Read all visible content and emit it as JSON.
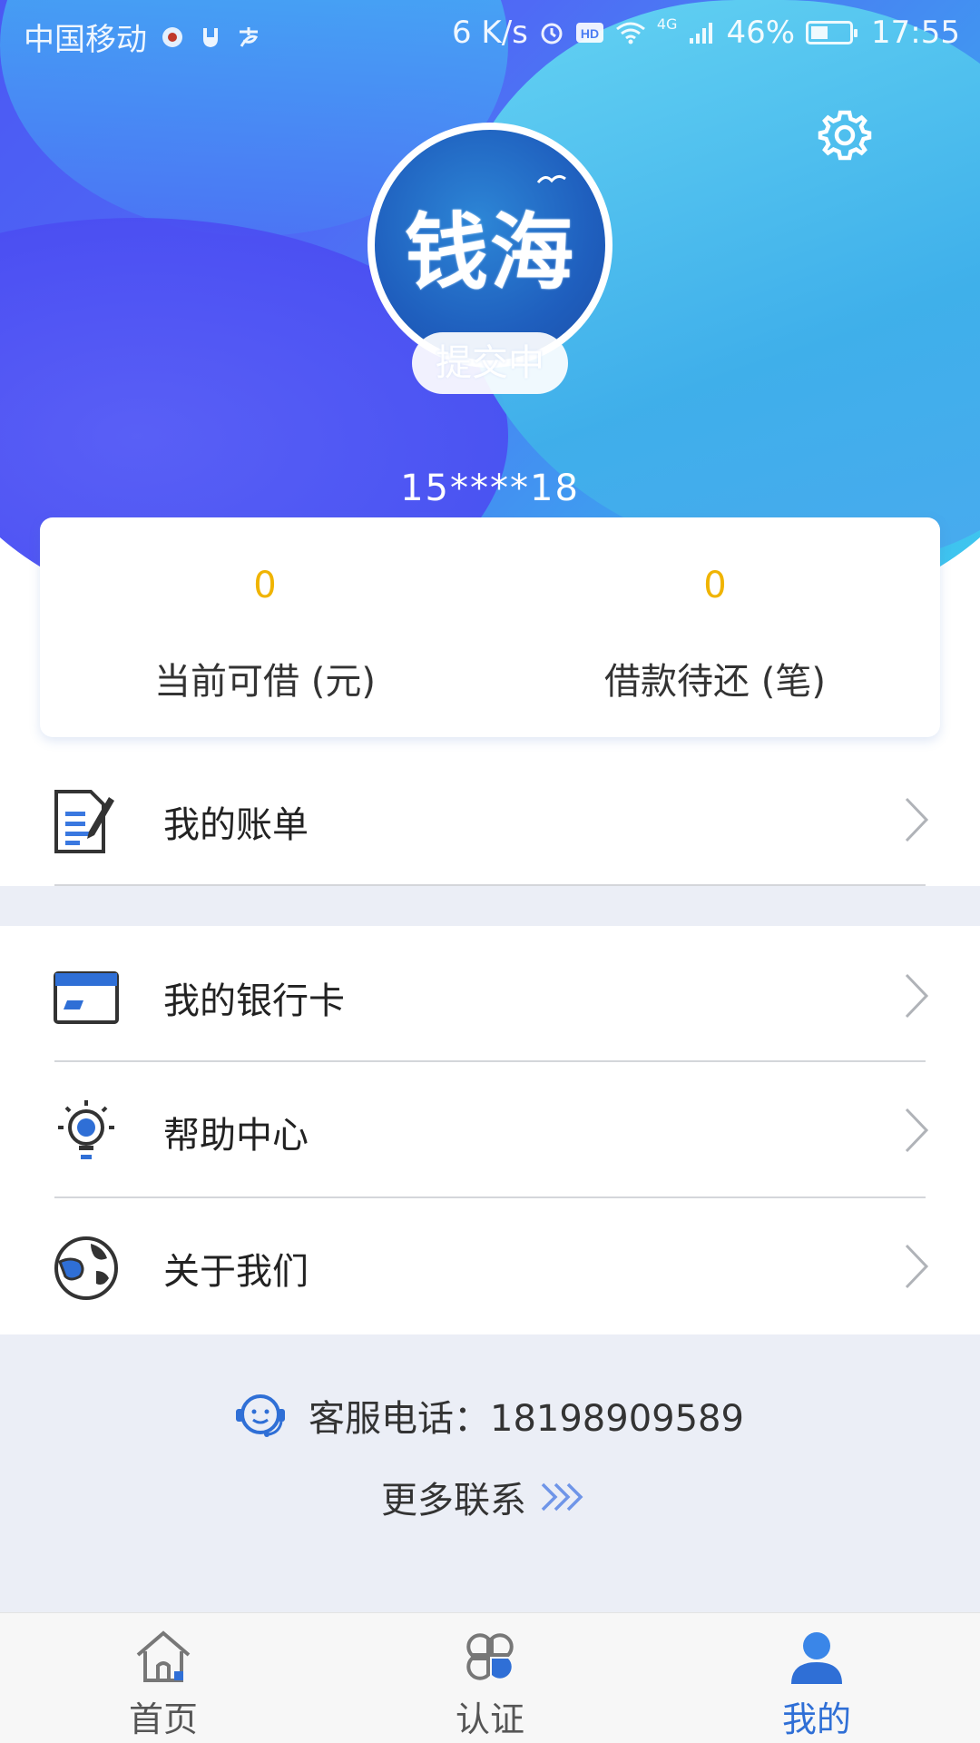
{
  "status_bar": {
    "carrier": "中国移动",
    "network_speed": "6 K/s",
    "network_type": "4G",
    "battery": "46%",
    "time": "17:55"
  },
  "profile": {
    "avatar_text": "钱海",
    "status_badge": "提交中",
    "phone": "15****18"
  },
  "stats": [
    {
      "value": "0",
      "label": "当前可借 (元)"
    },
    {
      "value": "0",
      "label": "借款待还 (笔)"
    }
  ],
  "menu": {
    "bill": "我的账单",
    "bank_card": "我的银行卡",
    "help": "帮助中心",
    "about": "关于我们"
  },
  "contact": {
    "phone_label": "客服电话：",
    "phone_number": "18198909589",
    "more": "更多联系"
  },
  "bottom_nav": [
    {
      "label": "首页",
      "icon": "home-icon"
    },
    {
      "label": "认证",
      "icon": "verify-icon"
    },
    {
      "label": "我的",
      "icon": "user-icon",
      "active": true
    }
  ],
  "colors": {
    "accent": "#2f6fd6",
    "stat_value": "#f0b400",
    "section_bg": "#ebeef6"
  }
}
